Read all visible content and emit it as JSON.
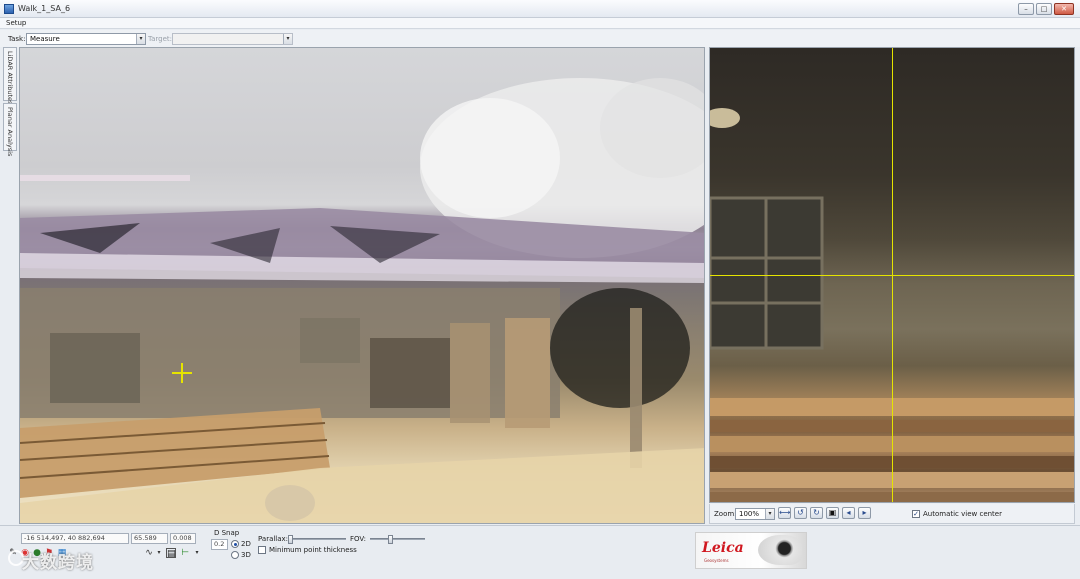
{
  "window": {
    "title": "Walk_1_SA_6"
  },
  "menu": {
    "items": [
      "Setup"
    ]
  },
  "task_bar": {
    "task_label": "Task:",
    "task_value": "Measure",
    "target_label": "Target:",
    "target_value": ""
  },
  "side_tabs": [
    "LiDAR Attributes",
    "Planar Analysis"
  ],
  "image_toolbar": {
    "zoom_label": "Zoom:",
    "zoom_value": "100%",
    "auto_center_label": "Automatic view center",
    "auto_center_checked": true
  },
  "bottom_panel": {
    "coords": "-16 514,497, 40 882,694",
    "elevation": "65.589",
    "precision": "0.008",
    "snap_title": "D Snap",
    "snap_value": "0.2",
    "snap_2d": "2D",
    "snap_3d": "3D",
    "snap_selected": "2D",
    "parallax_label": "Parallax:",
    "fov_label": "FOV:",
    "min_point_label": "Minimum point thickness",
    "min_point_checked": false
  },
  "logo": {
    "brand": "Leica",
    "sub": "Geosystems"
  },
  "watermark": {
    "text": "大数跨境"
  },
  "colors": {
    "crosshair": "#e5e400",
    "accent": "#2a4c8e",
    "brand_red": "#d0171f"
  },
  "icons": [
    "minimize-icon",
    "maximize-icon",
    "close-icon",
    "fit-icon",
    "rotate-left-icon",
    "rotate-right-icon",
    "film-icon",
    "prev-icon",
    "next-icon"
  ]
}
